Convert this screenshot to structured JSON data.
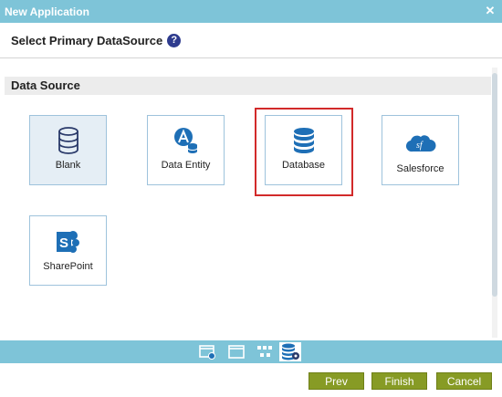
{
  "window": {
    "title": "New Application",
    "close_label": "✕"
  },
  "heading": {
    "title": "Select Primary DataSource",
    "help_label": "?"
  },
  "section": {
    "title": "Data Source"
  },
  "tiles": [
    {
      "label": "Blank",
      "icon": "database-stack-icon",
      "selected": true
    },
    {
      "label": "Data Entity",
      "icon": "data-entity-icon",
      "selected": false
    },
    {
      "label": "Database",
      "icon": "database-icon",
      "selected": false,
      "highlighted": true
    },
    {
      "label": "Salesforce",
      "icon": "salesforce-cloud-icon",
      "selected": false
    },
    {
      "label": "SharePoint",
      "icon": "sharepoint-icon",
      "selected": false
    }
  ],
  "steps": [
    {
      "icon": "app-window-icon"
    },
    {
      "icon": "blank-window-icon"
    },
    {
      "icon": "flow-diagram-icon"
    },
    {
      "icon": "database-gear-icon",
      "active": true
    }
  ],
  "footer": {
    "prev_label": "Prev",
    "finish_label": "Finish",
    "cancel_label": "Cancel"
  },
  "colors": {
    "titlebar": "#7ec4d8",
    "button": "#879b25",
    "icon_blue": "#1e6fb6",
    "highlight": "#d22a2a"
  }
}
